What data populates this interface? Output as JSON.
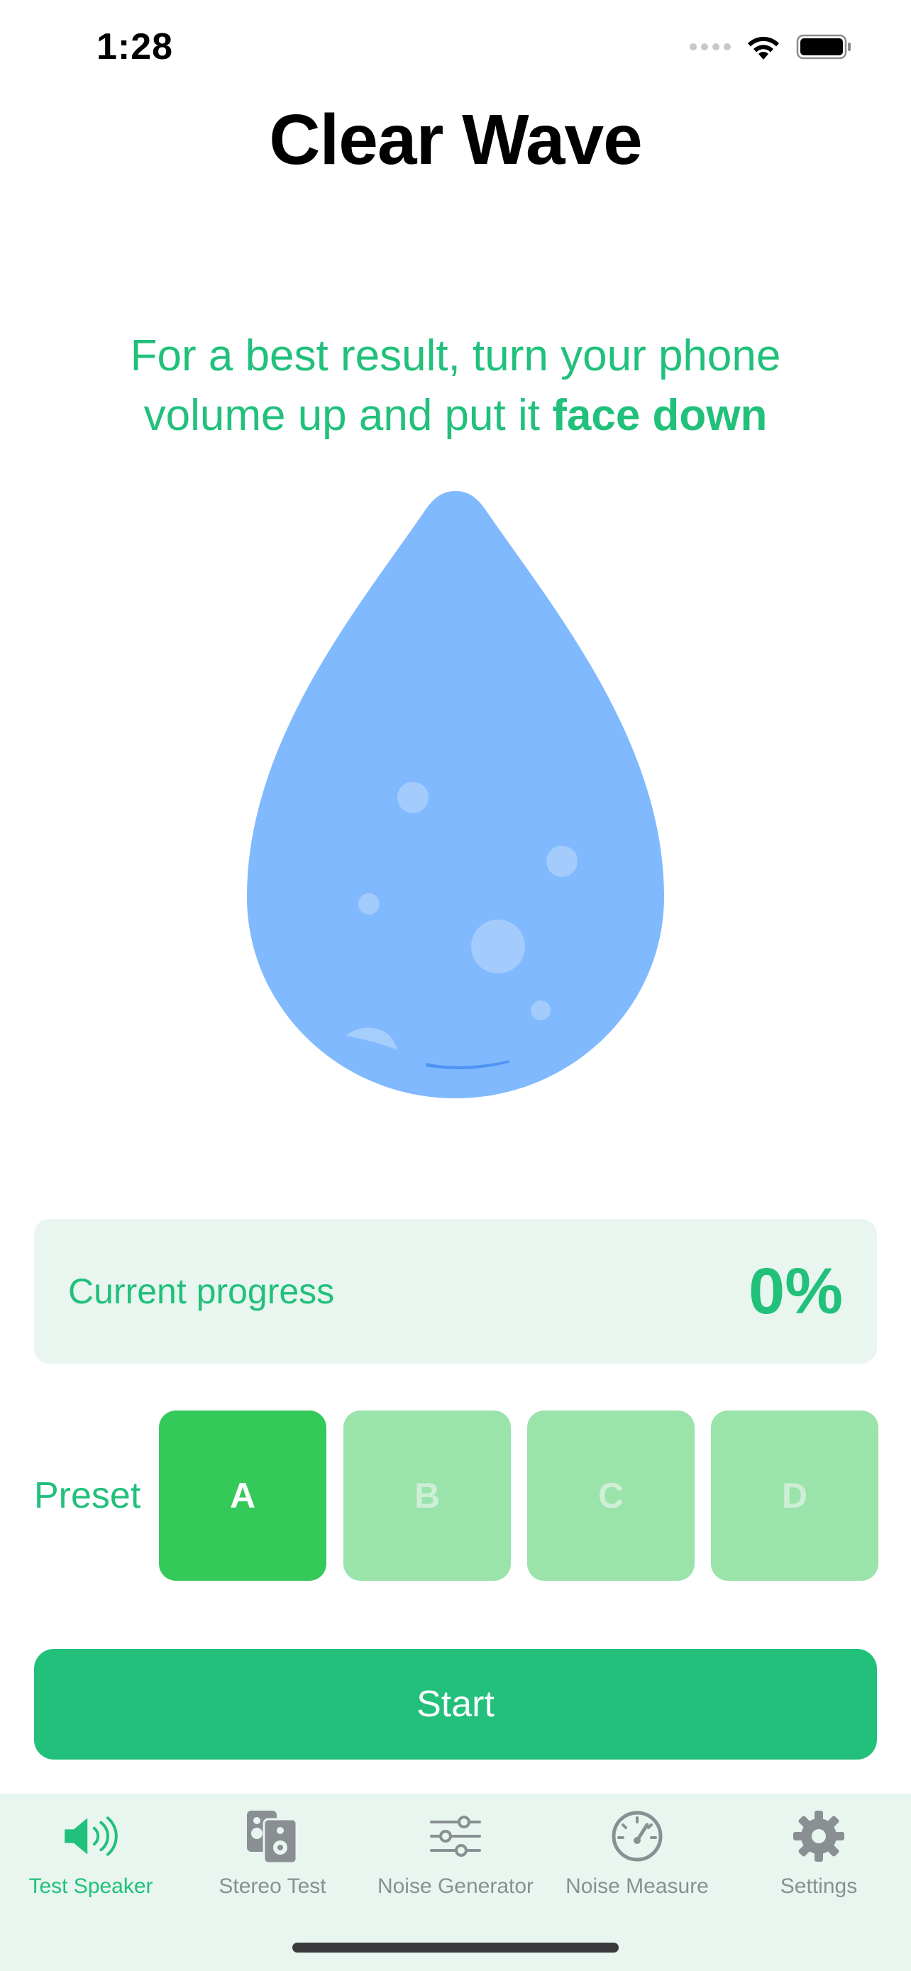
{
  "status_bar": {
    "time": "1:28"
  },
  "app": {
    "title": "Clear Wave"
  },
  "instruction": {
    "text_part1": "For a best result, turn your phone volume up and put it ",
    "text_bold": "face down"
  },
  "progress": {
    "label": "Current progress",
    "value": "0%"
  },
  "preset": {
    "label": "Preset",
    "options": [
      "A",
      "B",
      "C",
      "D"
    ],
    "selected": "A"
  },
  "start_button": {
    "label": "Start"
  },
  "tabs": [
    {
      "label": "Test Speaker",
      "icon": "speaker-wave-icon",
      "active": true
    },
    {
      "label": "Stereo Test",
      "icon": "stereo-speakers-icon",
      "active": false
    },
    {
      "label": "Noise Generator",
      "icon": "sliders-icon",
      "active": false
    },
    {
      "label": "Noise Measure",
      "icon": "gauge-icon",
      "active": false
    },
    {
      "label": "Settings",
      "icon": "gear-icon",
      "active": false
    }
  ],
  "colors": {
    "accent": "#21c07b",
    "drop": "#80b9fd",
    "preset_active": "#35c95a",
    "preset_inactive": "#9ae3ab",
    "card_bg": "#e8f6ef"
  }
}
